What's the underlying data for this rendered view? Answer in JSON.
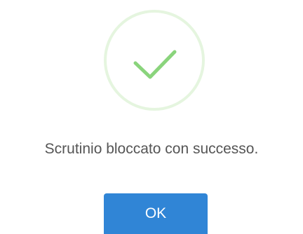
{
  "dialog": {
    "icon": "success-check-icon",
    "message": "Scrutinio bloccato con successo.",
    "confirm_label": "OK"
  },
  "colors": {
    "success_ring": "#e5f5df",
    "success_check": "#8ad47c",
    "text": "#555555",
    "button": "#3085d6",
    "button_text": "#ffffff"
  }
}
